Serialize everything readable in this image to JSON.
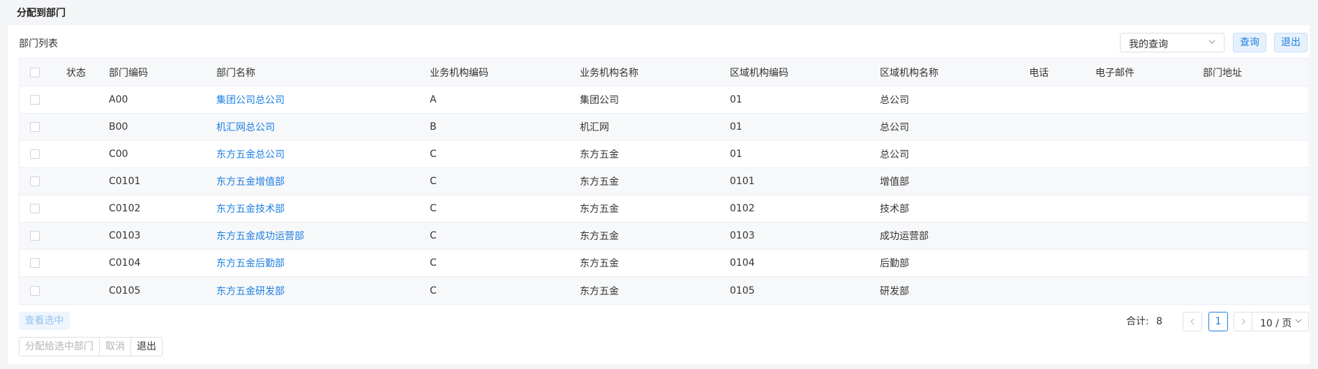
{
  "header": {
    "title": "分配到部门"
  },
  "list": {
    "title": "部门列表"
  },
  "toolbar": {
    "query_select_value": "我的查询",
    "query_button": "查询",
    "exit_button": "退出"
  },
  "table": {
    "columns": {
      "status": "状态",
      "code": "部门编码",
      "name": "部门名称",
      "business_code": "业务机构编码",
      "business_name": "业务机构名称",
      "region_code": "区域机构编码",
      "region_name": "区域机构名称",
      "phone": "电话",
      "email": "电子邮件",
      "address": "部门地址"
    },
    "rows": [
      {
        "code": "A00",
        "name": "集团公司总公司",
        "business_code": "A",
        "business_name": "集团公司",
        "region_code": "01",
        "region_name": "总公司"
      },
      {
        "code": "B00",
        "name": "机汇网总公司",
        "business_code": "B",
        "business_name": "机汇网",
        "region_code": "01",
        "region_name": "总公司"
      },
      {
        "code": "C00",
        "name": "东方五金总公司",
        "business_code": "C",
        "business_name": "东方五金",
        "region_code": "01",
        "region_name": "总公司"
      },
      {
        "code": "C0101",
        "name": "东方五金增值部",
        "business_code": "C",
        "business_name": "东方五金",
        "region_code": "0101",
        "region_name": "增值部"
      },
      {
        "code": "C0102",
        "name": "东方五金技术部",
        "business_code": "C",
        "business_name": "东方五金",
        "region_code": "0102",
        "region_name": "技术部"
      },
      {
        "code": "C0103",
        "name": "东方五金成功运营部",
        "business_code": "C",
        "business_name": "东方五金",
        "region_code": "0103",
        "region_name": "成功运营部"
      },
      {
        "code": "C0104",
        "name": "东方五金后勤部",
        "business_code": "C",
        "business_name": "东方五金",
        "region_code": "0104",
        "region_name": "后勤部"
      },
      {
        "code": "C0105",
        "name": "东方五金研发部",
        "business_code": "C",
        "business_name": "东方五金",
        "region_code": "0105",
        "region_name": "研发部"
      }
    ]
  },
  "footer": {
    "view_selected": "查看选中",
    "assign_button": "分配给选中部门",
    "cancel_button": "取消",
    "exit_button": "退出"
  },
  "pagination": {
    "total_label": "合计:",
    "total": "8",
    "current_page": "1",
    "page_size": "10 / 页",
    "prev_icon": "chevron-left-icon",
    "next_icon": "chevron-right-icon"
  },
  "colors": {
    "accent": "#1f7fe0",
    "header_bg": "#f7f8fa",
    "border": "#ebeef5"
  }
}
